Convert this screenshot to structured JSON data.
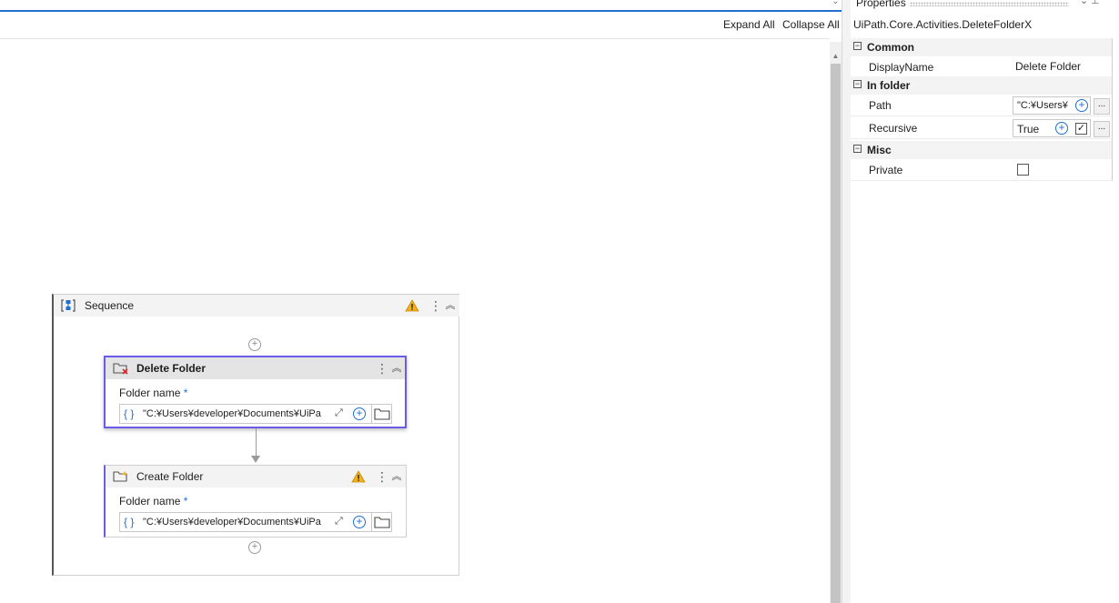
{
  "toolbar": {
    "expand_all": "Expand All",
    "collapse_all": "Collapse All"
  },
  "sequence": {
    "title": "Sequence",
    "activities": [
      {
        "title": "Delete Folder",
        "field_label": "Folder name",
        "required_mark": "*",
        "field_value": "\"C:¥Users¥developer¥Documents¥UiPa",
        "braces": "{ }"
      },
      {
        "title": "Create Folder",
        "field_label": "Folder name",
        "required_mark": "*",
        "field_value": "\"C:¥Users¥developer¥Documents¥UiPa",
        "braces": "{ }"
      }
    ]
  },
  "properties": {
    "title": "Properties",
    "type_name": "UiPath.Core.Activities.DeleteFolderX",
    "categories": [
      {
        "label": "Common",
        "rows": [
          {
            "name": "DisplayName",
            "value": "Delete Folder"
          }
        ]
      },
      {
        "label": "In folder",
        "rows": [
          {
            "name": "Path",
            "value": "\"C:¥Users¥"
          },
          {
            "name": "Recursive",
            "value": "True"
          }
        ]
      },
      {
        "label": "Misc",
        "rows": [
          {
            "name": "Private",
            "value": ""
          }
        ]
      }
    ],
    "ellipsis": "..."
  },
  "colors": {
    "accent": "#1f6fcf",
    "selection": "#6b5ce7",
    "warning": "#f2b01e"
  }
}
